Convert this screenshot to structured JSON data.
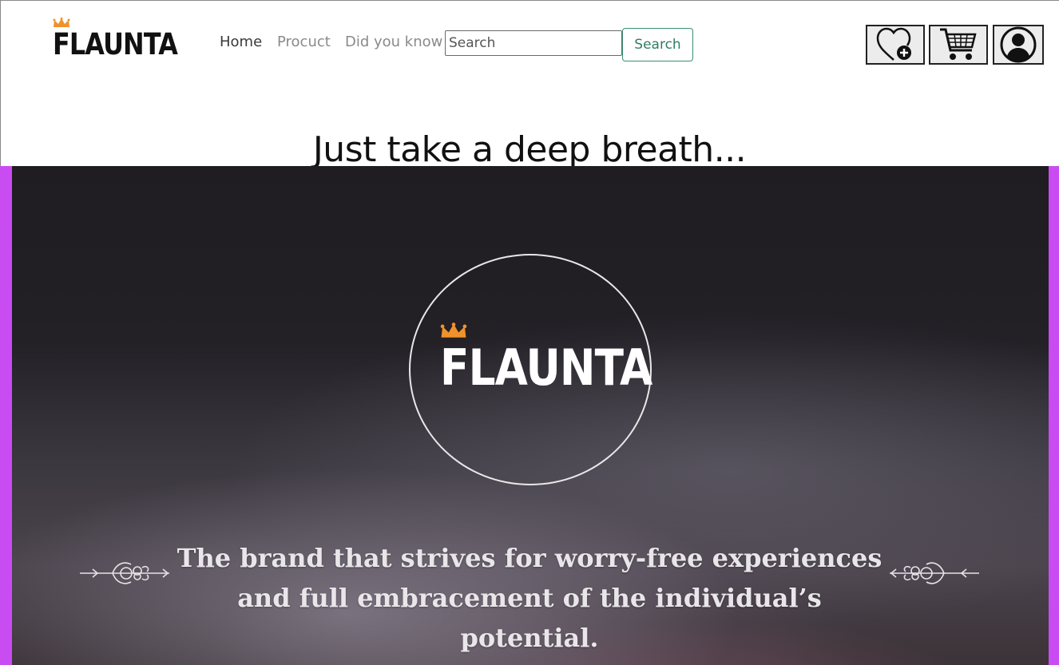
{
  "header": {
    "brand": "FLAUNTA",
    "nav": [
      {
        "label": "Home"
      },
      {
        "label": "Procuct"
      },
      {
        "label": "Did you know"
      }
    ],
    "search": {
      "placeholder": "Search",
      "button_label": "Search"
    },
    "icons": [
      "heart-plus-icon",
      "shopping-cart-icon",
      "user-account-icon"
    ]
  },
  "tagline": "Just take a deep breath...",
  "hero": {
    "brand": "FLAUNTA",
    "mission_line1": "The brand that strives for worry-free experiences",
    "mission_line2": "and full embracement of the individual’s potential."
  },
  "colors": {
    "crown": "#f0922b",
    "search_button": "#2f7d60",
    "hero_border": "#c94cf2"
  }
}
